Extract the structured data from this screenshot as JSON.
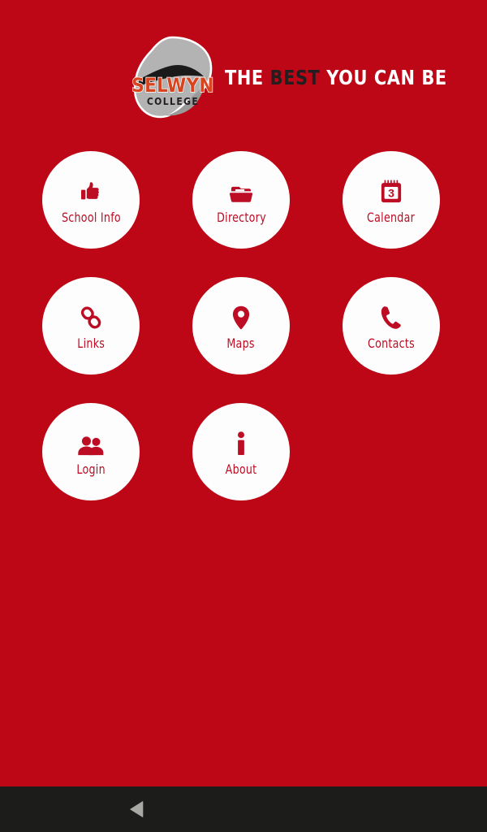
{
  "app": {
    "background_color": "#bd0717",
    "tile_color": "#fdfdfd",
    "accent_color": "#bd0d24",
    "navbar_color": "#1c1c1a"
  },
  "header": {
    "logo": {
      "name_text": "SELWYN",
      "sub_text": "COLLEGE",
      "name_color": "#d8441f",
      "sub_color": "#231f20",
      "badge_color": "#b3b3b3"
    },
    "tagline": {
      "part1": "THE",
      "part2": "BEST",
      "part3": "YOU CAN BE",
      "part1_color": "#ffffff",
      "part2_color": "#231f20",
      "part3_color": "#ffffff"
    }
  },
  "grid": {
    "tiles": [
      {
        "label": "School Info",
        "icon": "thumbs-up-icon"
      },
      {
        "label": "Directory",
        "icon": "folder-icon"
      },
      {
        "label": "Calendar",
        "icon": "calendar-icon"
      },
      {
        "label": "Links",
        "icon": "chain-link-icon"
      },
      {
        "label": "Maps",
        "icon": "map-pin-icon"
      },
      {
        "label": "Contacts",
        "icon": "phone-icon"
      },
      {
        "label": "Login",
        "icon": "users-icon"
      },
      {
        "label": "About",
        "icon": "info-icon"
      }
    ]
  },
  "calendar_icon": {
    "day_number": "3"
  },
  "navbar": {
    "back_label": "Back"
  }
}
